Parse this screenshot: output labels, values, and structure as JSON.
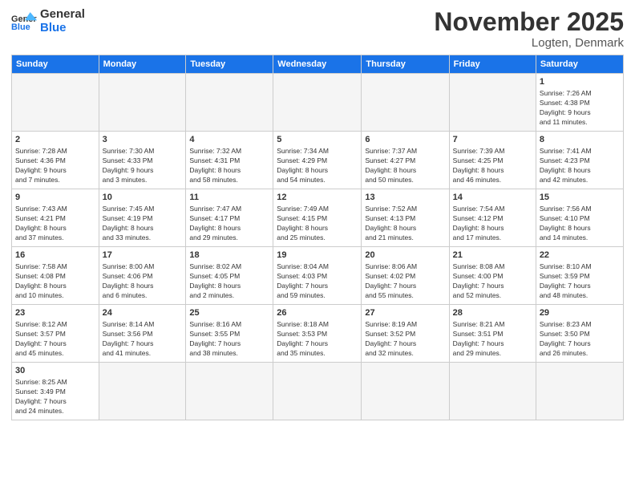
{
  "header": {
    "logo_general": "General",
    "logo_blue": "Blue",
    "month_title": "November 2025",
    "location": "Logten, Denmark"
  },
  "weekdays": [
    "Sunday",
    "Monday",
    "Tuesday",
    "Wednesday",
    "Thursday",
    "Friday",
    "Saturday"
  ],
  "weeks": [
    [
      {
        "day": "",
        "info": ""
      },
      {
        "day": "",
        "info": ""
      },
      {
        "day": "",
        "info": ""
      },
      {
        "day": "",
        "info": ""
      },
      {
        "day": "",
        "info": ""
      },
      {
        "day": "",
        "info": ""
      },
      {
        "day": "1",
        "info": "Sunrise: 7:26 AM\nSunset: 4:38 PM\nDaylight: 9 hours\nand 11 minutes."
      }
    ],
    [
      {
        "day": "2",
        "info": "Sunrise: 7:28 AM\nSunset: 4:36 PM\nDaylight: 9 hours\nand 7 minutes."
      },
      {
        "day": "3",
        "info": "Sunrise: 7:30 AM\nSunset: 4:33 PM\nDaylight: 9 hours\nand 3 minutes."
      },
      {
        "day": "4",
        "info": "Sunrise: 7:32 AM\nSunset: 4:31 PM\nDaylight: 8 hours\nand 58 minutes."
      },
      {
        "day": "5",
        "info": "Sunrise: 7:34 AM\nSunset: 4:29 PM\nDaylight: 8 hours\nand 54 minutes."
      },
      {
        "day": "6",
        "info": "Sunrise: 7:37 AM\nSunset: 4:27 PM\nDaylight: 8 hours\nand 50 minutes."
      },
      {
        "day": "7",
        "info": "Sunrise: 7:39 AM\nSunset: 4:25 PM\nDaylight: 8 hours\nand 46 minutes."
      },
      {
        "day": "8",
        "info": "Sunrise: 7:41 AM\nSunset: 4:23 PM\nDaylight: 8 hours\nand 42 minutes."
      }
    ],
    [
      {
        "day": "9",
        "info": "Sunrise: 7:43 AM\nSunset: 4:21 PM\nDaylight: 8 hours\nand 37 minutes."
      },
      {
        "day": "10",
        "info": "Sunrise: 7:45 AM\nSunset: 4:19 PM\nDaylight: 8 hours\nand 33 minutes."
      },
      {
        "day": "11",
        "info": "Sunrise: 7:47 AM\nSunset: 4:17 PM\nDaylight: 8 hours\nand 29 minutes."
      },
      {
        "day": "12",
        "info": "Sunrise: 7:49 AM\nSunset: 4:15 PM\nDaylight: 8 hours\nand 25 minutes."
      },
      {
        "day": "13",
        "info": "Sunrise: 7:52 AM\nSunset: 4:13 PM\nDaylight: 8 hours\nand 21 minutes."
      },
      {
        "day": "14",
        "info": "Sunrise: 7:54 AM\nSunset: 4:12 PM\nDaylight: 8 hours\nand 17 minutes."
      },
      {
        "day": "15",
        "info": "Sunrise: 7:56 AM\nSunset: 4:10 PM\nDaylight: 8 hours\nand 14 minutes."
      }
    ],
    [
      {
        "day": "16",
        "info": "Sunrise: 7:58 AM\nSunset: 4:08 PM\nDaylight: 8 hours\nand 10 minutes."
      },
      {
        "day": "17",
        "info": "Sunrise: 8:00 AM\nSunset: 4:06 PM\nDaylight: 8 hours\nand 6 minutes."
      },
      {
        "day": "18",
        "info": "Sunrise: 8:02 AM\nSunset: 4:05 PM\nDaylight: 8 hours\nand 2 minutes."
      },
      {
        "day": "19",
        "info": "Sunrise: 8:04 AM\nSunset: 4:03 PM\nDaylight: 7 hours\nand 59 minutes."
      },
      {
        "day": "20",
        "info": "Sunrise: 8:06 AM\nSunset: 4:02 PM\nDaylight: 7 hours\nand 55 minutes."
      },
      {
        "day": "21",
        "info": "Sunrise: 8:08 AM\nSunset: 4:00 PM\nDaylight: 7 hours\nand 52 minutes."
      },
      {
        "day": "22",
        "info": "Sunrise: 8:10 AM\nSunset: 3:59 PM\nDaylight: 7 hours\nand 48 minutes."
      }
    ],
    [
      {
        "day": "23",
        "info": "Sunrise: 8:12 AM\nSunset: 3:57 PM\nDaylight: 7 hours\nand 45 minutes."
      },
      {
        "day": "24",
        "info": "Sunrise: 8:14 AM\nSunset: 3:56 PM\nDaylight: 7 hours\nand 41 minutes."
      },
      {
        "day": "25",
        "info": "Sunrise: 8:16 AM\nSunset: 3:55 PM\nDaylight: 7 hours\nand 38 minutes."
      },
      {
        "day": "26",
        "info": "Sunrise: 8:18 AM\nSunset: 3:53 PM\nDaylight: 7 hours\nand 35 minutes."
      },
      {
        "day": "27",
        "info": "Sunrise: 8:19 AM\nSunset: 3:52 PM\nDaylight: 7 hours\nand 32 minutes."
      },
      {
        "day": "28",
        "info": "Sunrise: 8:21 AM\nSunset: 3:51 PM\nDaylight: 7 hours\nand 29 minutes."
      },
      {
        "day": "29",
        "info": "Sunrise: 8:23 AM\nSunset: 3:50 PM\nDaylight: 7 hours\nand 26 minutes."
      }
    ],
    [
      {
        "day": "30",
        "info": "Sunrise: 8:25 AM\nSunset: 3:49 PM\nDaylight: 7 hours\nand 24 minutes."
      },
      {
        "day": "",
        "info": ""
      },
      {
        "day": "",
        "info": ""
      },
      {
        "day": "",
        "info": ""
      },
      {
        "day": "",
        "info": ""
      },
      {
        "day": "",
        "info": ""
      },
      {
        "day": "",
        "info": ""
      }
    ]
  ]
}
